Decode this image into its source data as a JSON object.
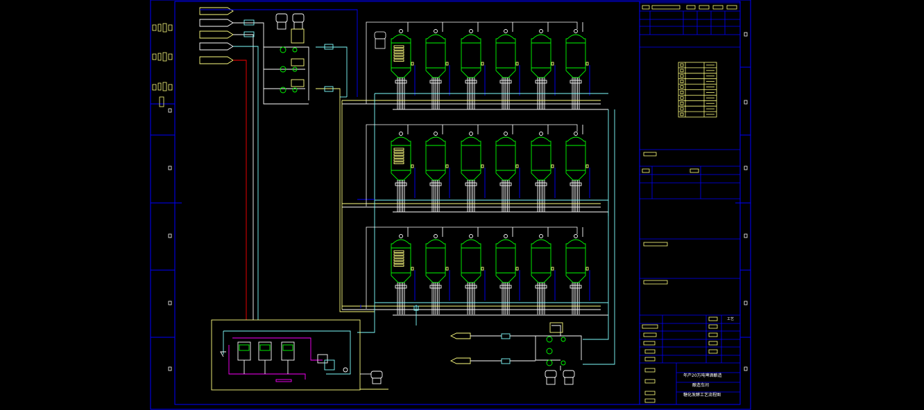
{
  "drawing": {
    "title_block": {
      "line1": "年产20万吨啤酒酿造",
      "line2": "酿造车间",
      "line3": "糖化发酵工艺流程图",
      "discipline": "工艺"
    },
    "colors": {
      "background": "#000000",
      "frame": "#0000ff",
      "vessel": "#00ff00",
      "pipe_white": "#ffffff",
      "pipe_cyan": "#80ffff",
      "pipe_yellow": "#ffff80",
      "pipe_red": "#ff0000",
      "pipe_magenta": "#ff00ff",
      "pipe_blue": "#0000ff"
    },
    "legend_rows": 10,
    "tank_rows": 3,
    "tanks_per_row": 6
  }
}
